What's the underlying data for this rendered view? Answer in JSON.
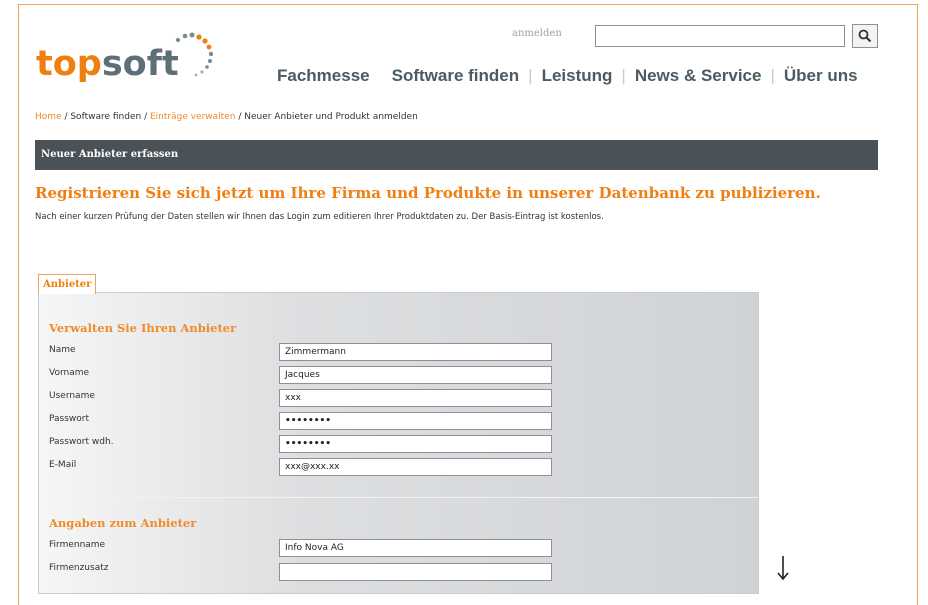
{
  "header": {
    "logo": {
      "part1": "top",
      "part2": "soft"
    },
    "login_label": "anmelden",
    "search": {
      "value": "",
      "placeholder": ""
    },
    "search_icon": "magnifier-icon"
  },
  "nav": {
    "items": [
      "Fachmesse",
      "Software finden",
      "Leistung",
      "News & Service",
      "Über uns"
    ],
    "separator": "|"
  },
  "breadcrumb": {
    "items": [
      "Home",
      "Software finden",
      "Einträge verwalten",
      "Neuer Anbieter und Produkt anmelden"
    ],
    "separator": " / "
  },
  "page": {
    "title_bar": "Neuer Anbieter erfassen",
    "headline": "Registrieren Sie sich jetzt um Ihre Firma und Produkte in unserer Datenbank zu publizieren.",
    "intro": "Nach einer kurzen Prüfung der Daten stellen wir Ihnen das Login zum editieren Ihrer Produktdaten zu. Der Basis-Eintrag ist kostenlos."
  },
  "form": {
    "tab_label": "Anbieter",
    "section1": {
      "title": "Verwalten Sie Ihren Anbieter",
      "fields": [
        {
          "label": "Name",
          "value": "Zimmermann"
        },
        {
          "label": "Vorname",
          "value": "Jacques"
        },
        {
          "label": "Username",
          "value": "xxx"
        },
        {
          "label": "Passwort",
          "value": "••••••••"
        },
        {
          "label": "Passwort wdh.",
          "value": "••••••••"
        },
        {
          "label": "E-Mail",
          "value": "xxx@xxx.xx"
        }
      ]
    },
    "section2": {
      "title": "Angaben zum Anbieter",
      "fields": [
        {
          "label": "Firmenname",
          "value": "Info Nova AG"
        },
        {
          "label": "Firmenzusatz",
          "value": ""
        }
      ]
    }
  },
  "annotation": {
    "icon": "down-arrow-icon"
  },
  "colors": {
    "accent": "#f07f12",
    "nav_text": "#4c5a63",
    "title_bar": "#4b5257",
    "frame_border": "#f0a35a"
  }
}
